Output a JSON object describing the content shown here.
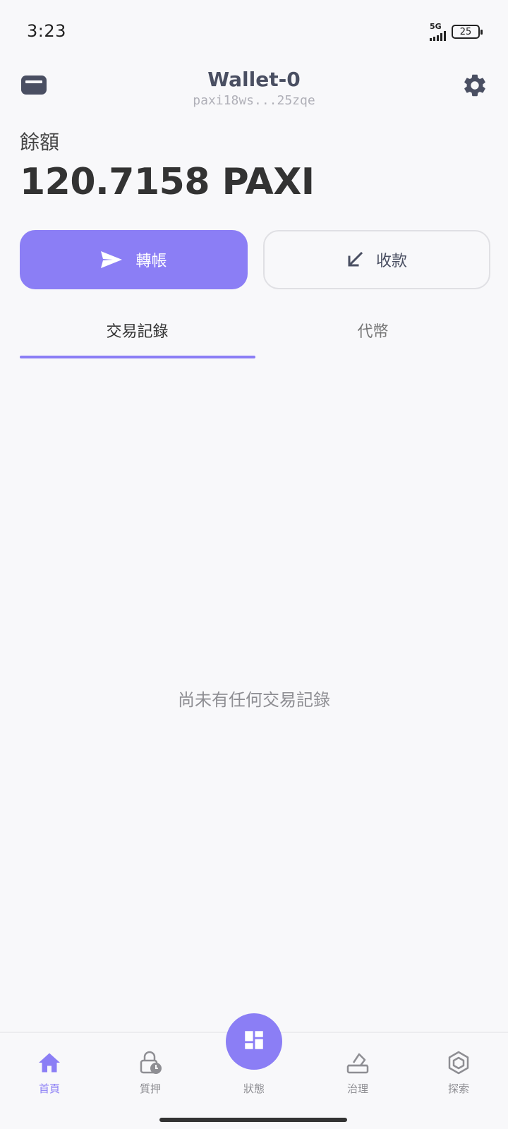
{
  "status_bar": {
    "time": "3:23",
    "network": "5G",
    "battery": "25"
  },
  "header": {
    "wallet_name": "Wallet-0",
    "wallet_address": "paxi18ws...25zqe",
    "wallet_icon": "wallet-icon",
    "settings_icon": "gear-icon"
  },
  "balance": {
    "label": "餘額",
    "value": "120.7158 PAXI"
  },
  "actions": {
    "send_label": "轉帳",
    "receive_label": "收款",
    "send_icon": "send-icon",
    "receive_icon": "arrow-down-left-icon"
  },
  "tabs": [
    {
      "label": "交易記錄",
      "active": true
    },
    {
      "label": "代幣",
      "active": false
    }
  ],
  "empty_state": "尚未有任何交易記錄",
  "bottom_nav": [
    {
      "label": "首頁",
      "icon": "home-icon",
      "active": true
    },
    {
      "label": "質押",
      "icon": "lock-clock-icon",
      "active": false
    },
    {
      "label": "狀態",
      "icon": "dashboard-icon",
      "active": false
    },
    {
      "label": "治理",
      "icon": "vote-icon",
      "active": false
    },
    {
      "label": "探索",
      "icon": "cube-icon",
      "active": false
    }
  ],
  "colors": {
    "accent": "#8b7ef5",
    "background": "#f8f8fa",
    "text_primary": "#333333",
    "text_muted": "#8e8e93",
    "icon_dark": "#4a4f62"
  }
}
